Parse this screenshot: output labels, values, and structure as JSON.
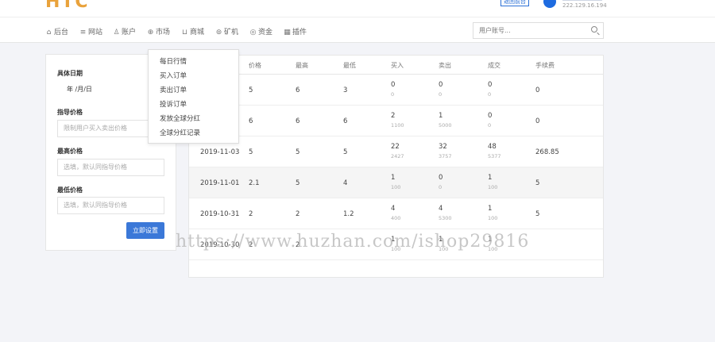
{
  "header": {
    "logo": "HTC",
    "back_button": "返回前台",
    "user_ip": "222.129.16.194"
  },
  "nav": {
    "items": [
      {
        "icon": "home-icon",
        "glyph": "⌂",
        "label": "后台"
      },
      {
        "icon": "list-icon",
        "glyph": "≡",
        "label": "网站"
      },
      {
        "icon": "users-icon",
        "glyph": "♙",
        "label": "账户"
      },
      {
        "icon": "globe-icon",
        "glyph": "⊕",
        "label": "市场"
      },
      {
        "icon": "cart-icon",
        "glyph": "⊔",
        "label": "商城"
      },
      {
        "icon": "miner-icon",
        "glyph": "⊚",
        "label": "矿机"
      },
      {
        "icon": "funds-icon",
        "glyph": "◎",
        "label": "资金"
      },
      {
        "icon": "plugin-icon",
        "glyph": "▦",
        "label": "插件"
      }
    ],
    "search_placeholder": "用户账号..."
  },
  "dropdown": {
    "items": [
      "每日行情",
      "买入订单",
      "卖出订单",
      "投诉订单",
      "发放全球分红",
      "全球分红记录"
    ]
  },
  "form": {
    "date_label": "具体日期",
    "date_value": "年 /月/日",
    "guide_label": "指导价格",
    "guide_placeholder": "限制用户买入卖出价格",
    "max_label": "最高价格",
    "max_placeholder": "选填，默认同指导价格",
    "min_label": "最低价格",
    "min_placeholder": "选填，默认同指导价格",
    "submit": "立即设置"
  },
  "table": {
    "headers": [
      "价格",
      "最高",
      "最低",
      "买入",
      "卖出",
      "成交",
      "手续费"
    ],
    "rows": [
      {
        "date": "",
        "price": "5",
        "high": "6",
        "low": "3",
        "buy": "0",
        "buy_sub": "0",
        "sell": "0",
        "sell_sub": "0",
        "deal": "0",
        "deal_sub": "0",
        "fee": "0"
      },
      {
        "date": "",
        "price": "6",
        "high": "6",
        "low": "6",
        "buy": "2",
        "buy_sub": "1100",
        "sell": "1",
        "sell_sub": "5000",
        "deal": "0",
        "deal_sub": "0",
        "fee": "0"
      },
      {
        "date": "2019-11-03",
        "price": "5",
        "high": "5",
        "low": "5",
        "buy": "22",
        "buy_sub": "2427",
        "sell": "32",
        "sell_sub": "3757",
        "deal": "48",
        "deal_sub": "5377",
        "fee": "268.85"
      },
      {
        "date": "2019-11-01",
        "price": "2.1",
        "high": "5",
        "low": "4",
        "buy": "1",
        "buy_sub": "100",
        "sell": "0",
        "sell_sub": "0",
        "deal": "1",
        "deal_sub": "100",
        "fee": "5"
      },
      {
        "date": "2019-10-31",
        "price": "2",
        "high": "2",
        "low": "1.2",
        "buy": "4",
        "buy_sub": "400",
        "sell": "4",
        "sell_sub": "5300",
        "deal": "1",
        "deal_sub": "100",
        "fee": "5"
      },
      {
        "date": "2019-10-30",
        "price": "2",
        "high": "2",
        "low": "",
        "buy": "1",
        "buy_sub": "100",
        "sell": "1",
        "sell_sub": "100",
        "deal": "1",
        "deal_sub": "100",
        "fee": ""
      }
    ]
  },
  "watermark": "https://www.huzhan.com/ishop29816"
}
